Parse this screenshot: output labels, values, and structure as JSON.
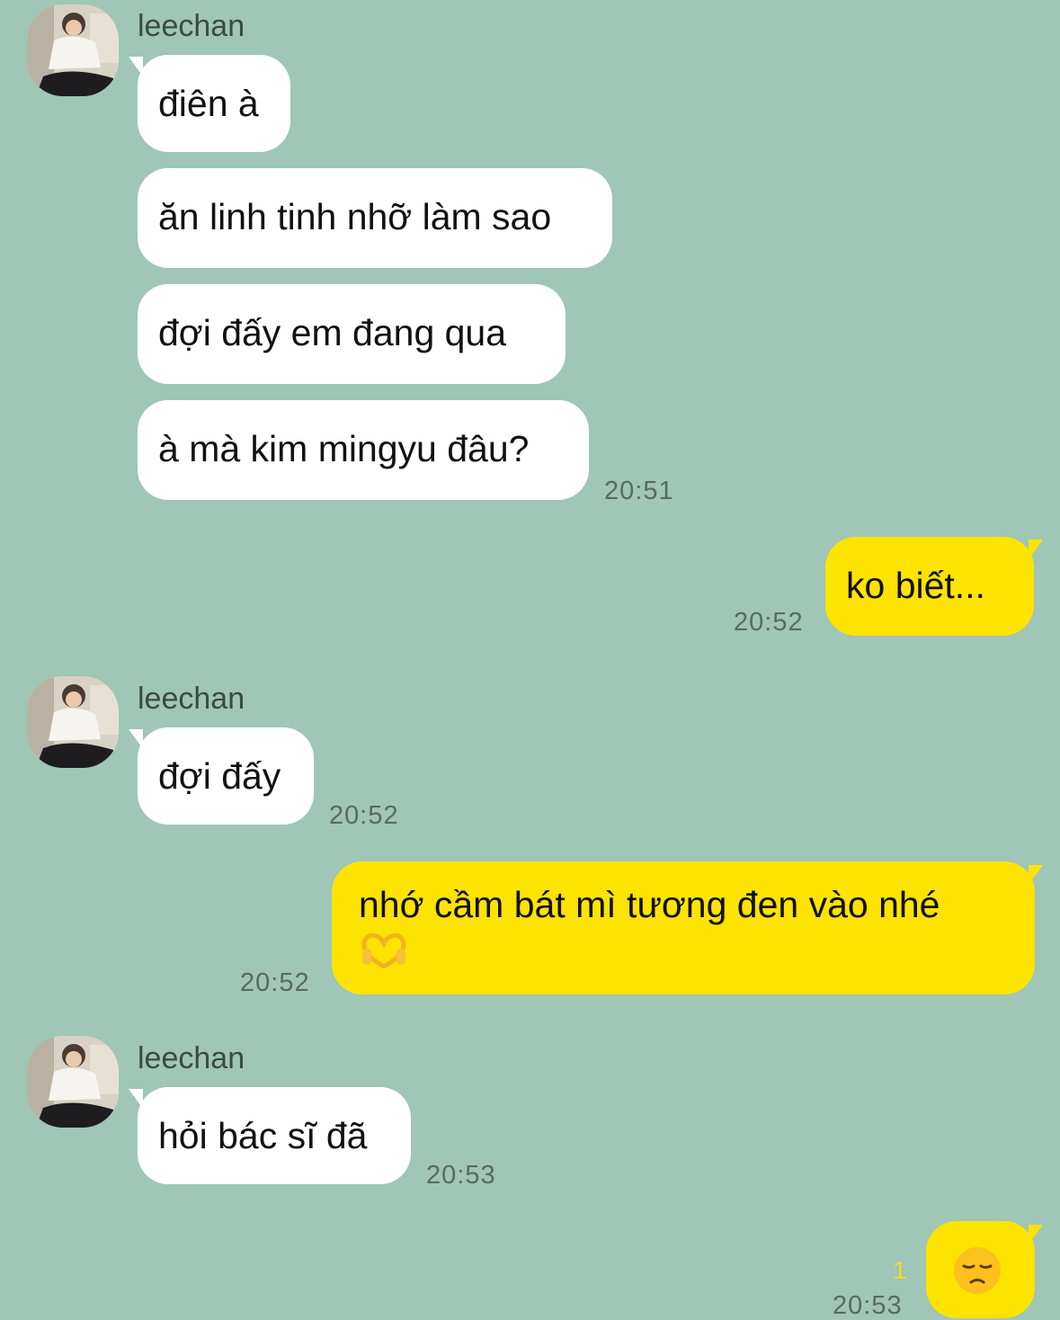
{
  "colors": {
    "background": "#9fc6b6",
    "incoming_bubble": "#ffffff",
    "outgoing_bubble": "#fde300",
    "timestamp": "#5a6a63",
    "unread_count": "#f2dc24"
  },
  "chat": {
    "group1": {
      "sender": "leechan",
      "avatar_icon": "profile-photo-icon",
      "messages": [
        "điên à",
        "ăn linh tinh nhỡ làm sao",
        "đợi đấy em đang qua",
        "à mà kim mingyu đâu?"
      ],
      "time": "20:51"
    },
    "out1": {
      "text": "ko biết...",
      "time": "20:52"
    },
    "group2": {
      "sender": "leechan",
      "messages": [
        "đợi đấy"
      ],
      "time": "20:52"
    },
    "out2": {
      "text": "nhớ cầm bát mì tương đen vào nhé",
      "emoji": "heart-hands-emoji",
      "time": "20:52"
    },
    "group3": {
      "sender": "leechan",
      "messages": [
        "hỏi bác sĩ đã"
      ],
      "time": "20:53"
    },
    "out3": {
      "emoji": "pensive-face-emoji",
      "unread": "1",
      "time": "20:53"
    }
  }
}
